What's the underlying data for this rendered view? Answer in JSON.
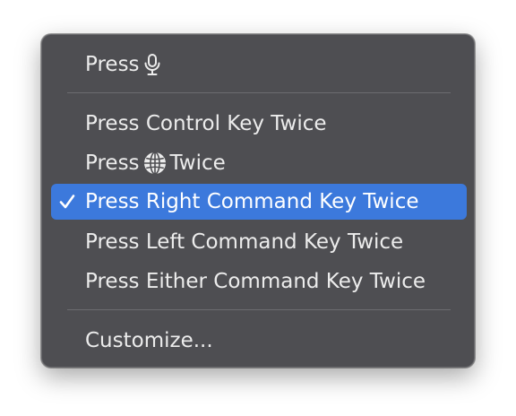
{
  "menu": {
    "items": [
      {
        "label_before": "Press",
        "icon": "microphone-icon",
        "label_after": ""
      },
      {
        "label": "Press Control Key Twice"
      },
      {
        "label_before": "Press",
        "icon": "globe-icon",
        "label_after": "Twice"
      },
      {
        "label": "Press Right Command Key Twice",
        "checked": true
      },
      {
        "label": "Press Left Command Key Twice"
      },
      {
        "label": "Press Either Command Key Twice"
      },
      {
        "label": "Customize..."
      }
    ],
    "checkmark_icon": "checkmark-icon",
    "selected_color": "#3c79dc",
    "background_color": "#4e4e52"
  }
}
